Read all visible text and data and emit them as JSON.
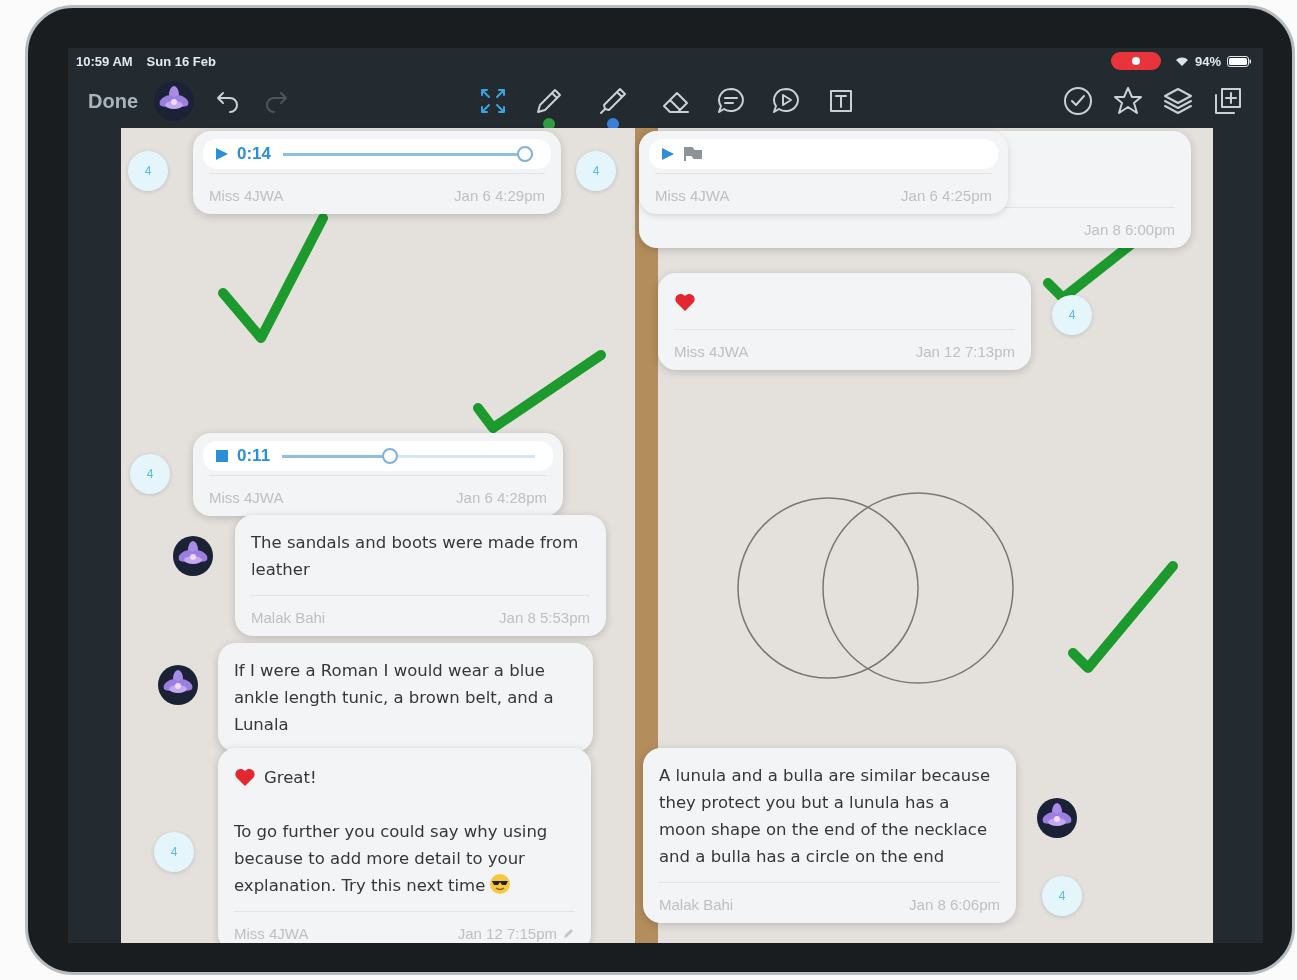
{
  "status_bar": {
    "time": "10:59 AM",
    "date": "Sun 16 Feb",
    "recording": true,
    "battery": "94%"
  },
  "toolbar": {
    "done": "Done",
    "history": [
      {
        "kind": "undo",
        "disabled": false
      },
      {
        "kind": "redo",
        "disabled": true
      }
    ],
    "tools": [
      {
        "kind": "fit"
      },
      {
        "kind": "pen",
        "color": "#2e9e3e"
      },
      {
        "kind": "marker",
        "color": "#3b7fd9"
      },
      {
        "kind": "eraser"
      },
      {
        "kind": "comment"
      },
      {
        "kind": "video"
      },
      {
        "kind": "textbox"
      }
    ],
    "actions": [
      {
        "kind": "check"
      },
      {
        "kind": "star"
      },
      {
        "kind": "layers"
      },
      {
        "kind": "add_page"
      }
    ]
  },
  "comments": [
    {
      "kind": "audio",
      "playing": false,
      "time": "0:14",
      "level": 1,
      "author": "Miss 4JWA",
      "date": "Jan 6 4:29pm",
      "badge": "4"
    },
    {
      "kind": "stub",
      "date": "Jan 8 6:00pm"
    },
    {
      "kind": "video",
      "author": "Miss 4JWA",
      "date": "Jan 6 4:25pm",
      "badge": "4"
    },
    {
      "kind": "text",
      "liked": true,
      "author": "Miss 4JWA",
      "date": "Jan 12 7:13pm",
      "badge": "4"
    },
    {
      "kind": "audio",
      "playing": true,
      "time": "0:11",
      "level": 0.42,
      "author": "Miss 4JWA",
      "date": "Jan 6 4:28pm",
      "badge": "4"
    },
    {
      "kind": "text",
      "avatar": true,
      "text": "The sandals and boots were made from leather",
      "author": "Malak Bahi",
      "date": "Jan 8 5:53pm"
    },
    {
      "kind": "text",
      "avatar": true,
      "text": "If I were a Roman I would wear a blue ankle length tunic, a brown belt, and a Lunala"
    },
    {
      "kind": "text",
      "liked": true,
      "text": "Great!",
      "body": "To go further you could say why using because to add more detail to your explanation.  Try this next time",
      "emoji": true,
      "author": "Miss 4JWA",
      "date": "Jan 12 7:15pm",
      "edited": true,
      "badge": "4"
    },
    {
      "kind": "text",
      "avatar": true,
      "text": "A lunula and a bulla are similar because they protect you but a lunula has a moon shape on the end of the necklace and a bulla has a circle on the end",
      "author": "Malak Bahi",
      "date": "Jan 8 6:06pm",
      "badge": "4"
    }
  ]
}
